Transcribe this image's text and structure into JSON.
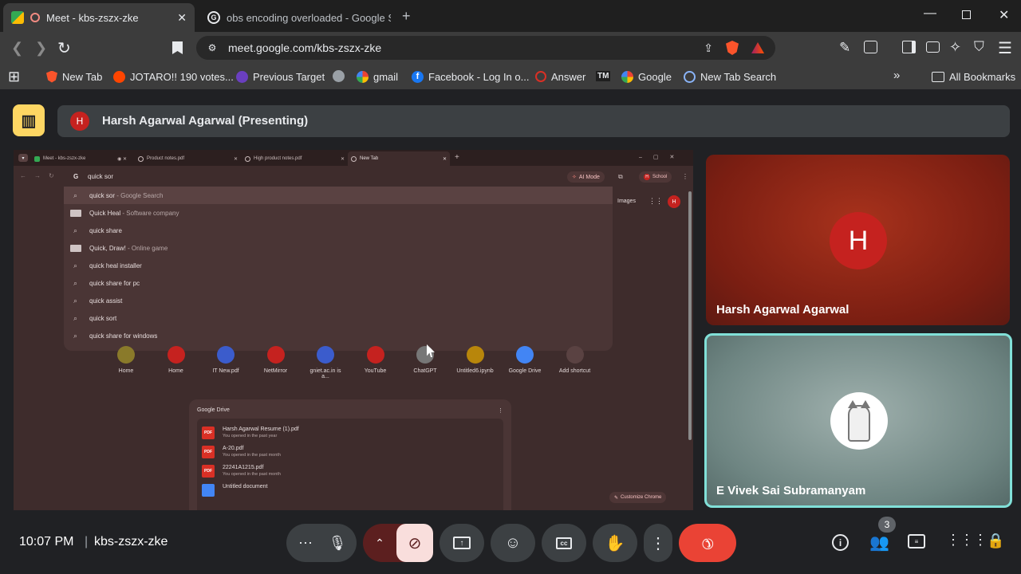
{
  "browser": {
    "tabs": [
      {
        "title": "Meet - kbs-zszx-zke"
      },
      {
        "title": "obs encoding overloaded - Google S"
      }
    ],
    "url": "meet.google.com/kbs-zszx-zke",
    "bookmarks": [
      "New Tab",
      "JOTARO!! 190 votes...",
      "Previous Target",
      "gmail",
      "Facebook - Log In o...",
      "Answer",
      "Google",
      "New Tab Search"
    ],
    "all_bookmarks": "All Bookmarks"
  },
  "meet": {
    "presenter_avatar": "H",
    "presenter_label": "Harsh Agarwal Agarwal (Presenting)",
    "participants": [
      {
        "name": "Harsh Agarwal Agarwal",
        "avatar": "H"
      },
      {
        "name": "E Vivek Sai Subramanyam"
      }
    ],
    "time": "10:07 PM",
    "meeting_code": "kbs-zszx-zke",
    "people_count": "3"
  },
  "shared": {
    "tabs": [
      "Meet - kbs-zszx-zke",
      "Product notes.pdf",
      "High product notes.pdf",
      "New Tab"
    ],
    "query": "quick sor",
    "ai_mode": "AI Mode",
    "profile": "School",
    "images": "Images",
    "avatar": "H",
    "suggestions": [
      {
        "main": "quick sor",
        "sub": " - Google Search",
        "type": "search"
      },
      {
        "main": "Quick Heal",
        "sub": " - Software company",
        "type": "img"
      },
      {
        "main": "quick share",
        "sub": "",
        "type": "search"
      },
      {
        "main": "Quick, Draw!",
        "sub": " - Online game",
        "type": "img"
      },
      {
        "main": "quick heal installer",
        "sub": "",
        "type": "search"
      },
      {
        "main": "quick share for pc",
        "sub": "",
        "type": "search"
      },
      {
        "main": "quick assist",
        "sub": "",
        "type": "search"
      },
      {
        "main": "quick sort",
        "sub": "",
        "type": "search"
      },
      {
        "main": "quick share for windows",
        "sub": "",
        "type": "search"
      }
    ],
    "shortcuts": [
      "Home",
      "Home",
      "IT New.pdf",
      "NetMirror",
      "gniet.ac.in is a...",
      "YouTube",
      "ChatGPT",
      "Untitled6.ipynb",
      "Google Drive",
      "Add shortcut"
    ],
    "drive": {
      "title": "Google Drive",
      "files": [
        {
          "name": "Harsh Agarwal Resume (1).pdf",
          "meta": "You opened in the past year"
        },
        {
          "name": "A-20.pdf",
          "meta": "You opened in the past month"
        },
        {
          "name": "22241A1215.pdf",
          "meta": "You opened in the past month"
        },
        {
          "name": "Untitled document",
          "meta": ""
        }
      ]
    },
    "customize": "Customize Chrome"
  },
  "colors": {
    "end_call": "#ea4335",
    "camera_off": "#f9dedc",
    "speaker_border": "#81e0d8"
  }
}
